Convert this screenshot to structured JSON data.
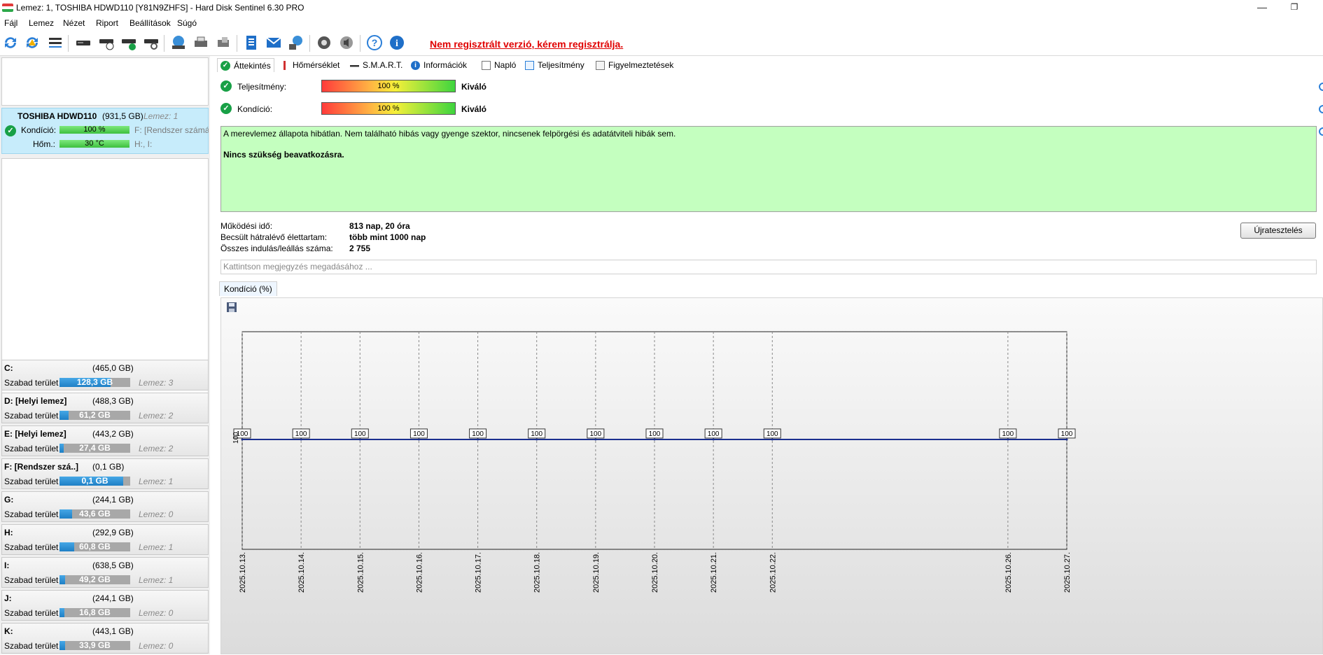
{
  "window": {
    "title": "Lemez: 1, TOSHIBA HDWD110 [Y81N9ZHFS]  -  Hard Disk Sentinel 6.30 PRO",
    "minimize_glyph": "—",
    "restore_glyph": "❐"
  },
  "menu": [
    "Fájl",
    "Lemez",
    "Nézet",
    "Riport",
    "Beállítások",
    "Súgó"
  ],
  "toolbar": {
    "icons": [
      "refresh-icon",
      "refresh-warning-icon",
      "disk-list-icon",
      "disk-test-icon",
      "disk-schedule-icon",
      "disk-check-icon",
      "disk-search-icon",
      "globe-disk-icon",
      "printer-icon",
      "hdd-icon",
      "report-icon",
      "email-icon",
      "network-icon",
      "settings-icon",
      "sound-icon",
      "help-icon",
      "info-icon"
    ],
    "notice": "Nem regisztrált verzió, kérem regisztrálja."
  },
  "disk": {
    "name": "TOSHIBA HDWD110",
    "size": "(931,5 GB)",
    "number": "Lemez: 1",
    "condition_label": "Kondíció:",
    "condition_value": "100 %",
    "condition_percent": 100,
    "temp_label": "Hőm.:",
    "temp_value": "30 °C",
    "partition_line1": "F: [Rendszer számára",
    "partition_line2": "H:, I:"
  },
  "drives": [
    {
      "letter": "C:",
      "size": "(465,0 GB)",
      "free_label": "Szabad terület",
      "free": "128,3 GB",
      "free_fraction": 0.28,
      "disk": "Lemez: 3"
    },
    {
      "letter": "D: [Helyi lemez]",
      "size": "(488,3 GB)",
      "free_label": "Szabad terület",
      "free": "61,2 GB",
      "free_fraction": 0.87,
      "disk": "Lemez: 2"
    },
    {
      "letter": "E: [Helyi lemez]",
      "size": "(443,2 GB)",
      "free_label": "Szabad terület",
      "free": "27,4 GB",
      "free_fraction": 0.94,
      "disk": "Lemez: 2"
    },
    {
      "letter": "F: [Rendszer szá..]",
      "size": "(0,1 GB)",
      "free_label": "Szabad terület",
      "free": "0,1 GB",
      "free_fraction": 0.1,
      "disk": "Lemez: 1"
    },
    {
      "letter": "G:",
      "size": "(244,1 GB)",
      "free_label": "Szabad terület",
      "free": "43,6 GB",
      "free_fraction": 0.82,
      "disk": "Lemez: 0"
    },
    {
      "letter": "H:",
      "size": "(292,9 GB)",
      "free_label": "Szabad terület",
      "free": "60,8 GB",
      "free_fraction": 0.79,
      "disk": "Lemez: 1"
    },
    {
      "letter": "I:",
      "size": "(638,5 GB)",
      "free_label": "Szabad terület",
      "free": "49,2 GB",
      "free_fraction": 0.92,
      "disk": "Lemez: 1"
    },
    {
      "letter": "J:",
      "size": "(244,1 GB)",
      "free_label": "Szabad terület",
      "free": "16,8 GB",
      "free_fraction": 0.93,
      "disk": "Lemez: 0"
    },
    {
      "letter": "K:",
      "size": "(443,1 GB)",
      "free_label": "Szabad terület",
      "free": "33,9 GB",
      "free_fraction": 0.92,
      "disk": "Lemez: 0"
    }
  ],
  "tabs": [
    "Áttekintés",
    "Hőmérséklet",
    "S.M.A.R.T.",
    "Információk",
    "Napló",
    "Teljesítmény",
    "Figyelmeztetések"
  ],
  "overview": {
    "performance_label": "Teljesítmény:",
    "performance_value": "100 %",
    "performance_percent": 100,
    "performance_rating": "Kiváló",
    "health_label": "Kondíció:",
    "health_value": "100 %",
    "health_percent": 100,
    "health_rating": "Kiváló",
    "message_line1": "A merevlemez állapota hibátlan. Nem található hibás vagy gyenge szektor, nincsenek felpörgési és adatátviteli hibák sem.",
    "message_line2": "Nincs szükség beavatkozásra.",
    "uptime_label": "Működési idő:",
    "uptime_value": "813 nap, 20 óra",
    "lifetime_label": "Becsült hátralévő élettartam:",
    "lifetime_value": "több mint 1000 nap",
    "startstop_label": "Összes indulás/leállás száma:",
    "startstop_value": "2 755",
    "retest_button": "Újratesztelés",
    "note_placeholder": "Kattintson megjegyzés megadásához ..."
  },
  "chart_tab": "Kondíció  (%)",
  "chart_data": {
    "type": "line",
    "x": [
      "2025.10.13.",
      "2025.10.14.",
      "2025.10.15.",
      "2025.10.16.",
      "2025.10.17.",
      "2025.10.18.",
      "2025.10.19.",
      "2025.10.20.",
      "2025.10.21.",
      "2025.10.22.",
      "2025.10.26.",
      "2025.10.27."
    ],
    "series": [
      {
        "values": [
          100,
          100,
          100,
          100,
          100,
          100,
          100,
          100,
          100,
          100,
          100,
          100
        ]
      }
    ],
    "y_tick": "100",
    "grid": "vertical",
    "line_color": "#1a2f8f"
  }
}
